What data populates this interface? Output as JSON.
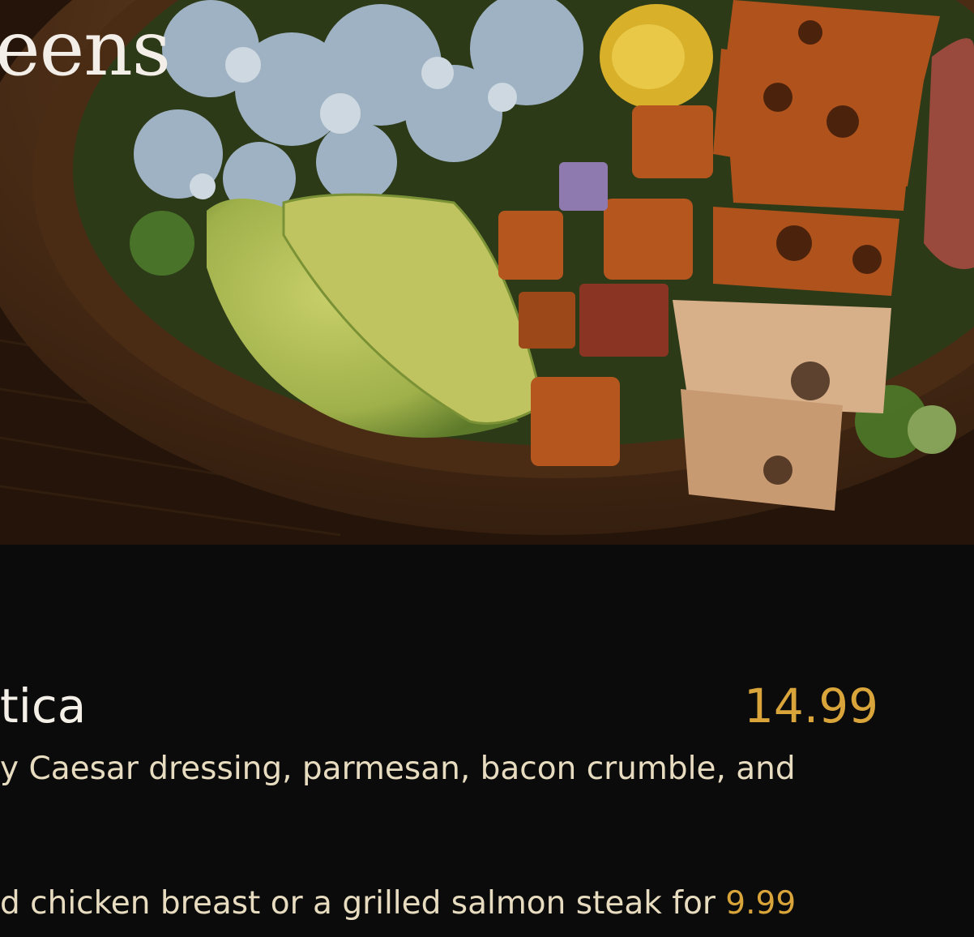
{
  "hero": {
    "title_fragment": "eens",
    "image_subject": "salad bowl with blue cheese, avocado, roasted vegetables and grilled chicken"
  },
  "menu_item": {
    "name_fragment": "tica",
    "price": "14.99",
    "description_fragment": "y Caesar dressing, parmesan, bacon crumble, and"
  },
  "addon": {
    "text_fragment": "d chicken breast or a grilled salmon steak for ",
    "price": "9.99"
  },
  "colors": {
    "background": "#0b0b0b",
    "accent_price": "#d9a53b",
    "text_primary": "#f4f0e8",
    "text_secondary": "#e8dcc0"
  }
}
